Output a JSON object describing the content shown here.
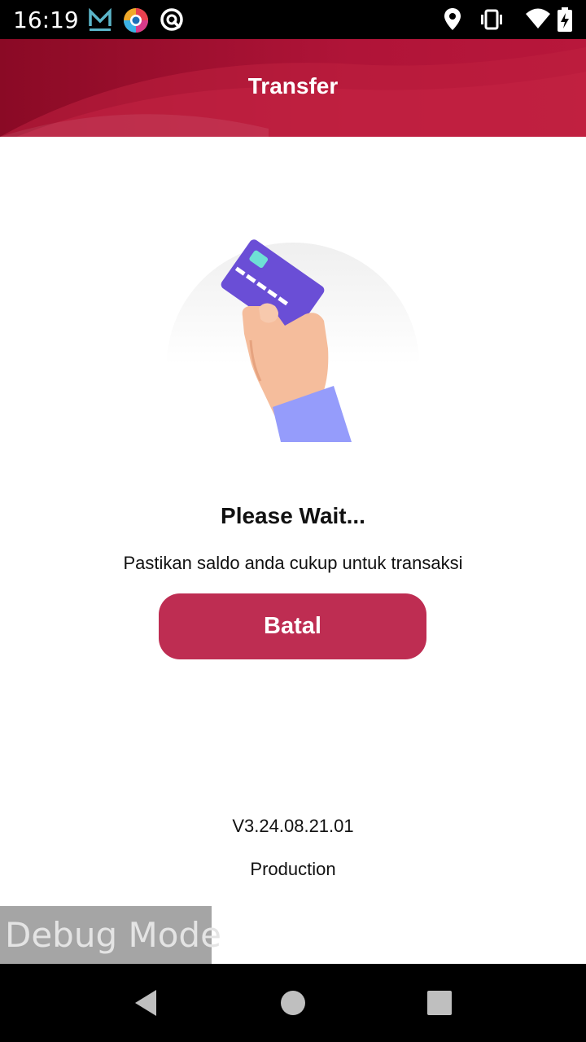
{
  "status_bar": {
    "time": "16:19",
    "left_icons": [
      "m-app-icon",
      "colorful-circle-app-icon",
      "q-app-icon"
    ],
    "right_icons": [
      "location-icon",
      "vibrate-icon",
      "wifi-icon",
      "battery-charging-icon"
    ]
  },
  "app_bar": {
    "title": "Transfer",
    "colors": {
      "primary": "#8a0a25",
      "secondary": "#b8173b"
    }
  },
  "main": {
    "illustration": "hand-holding-credit-card",
    "title": "Please Wait...",
    "subtitle": "Pastikan saldo anda cukup untuk transaksi",
    "cancel_label": "Batal",
    "button_color": "#be2d52"
  },
  "footer": {
    "version": "V3.24.08.21.01",
    "environment": "Production"
  },
  "debug_banner": "Debug Mode",
  "nav_bar": {
    "icons": [
      "back-icon",
      "home-icon",
      "recents-icon"
    ]
  }
}
